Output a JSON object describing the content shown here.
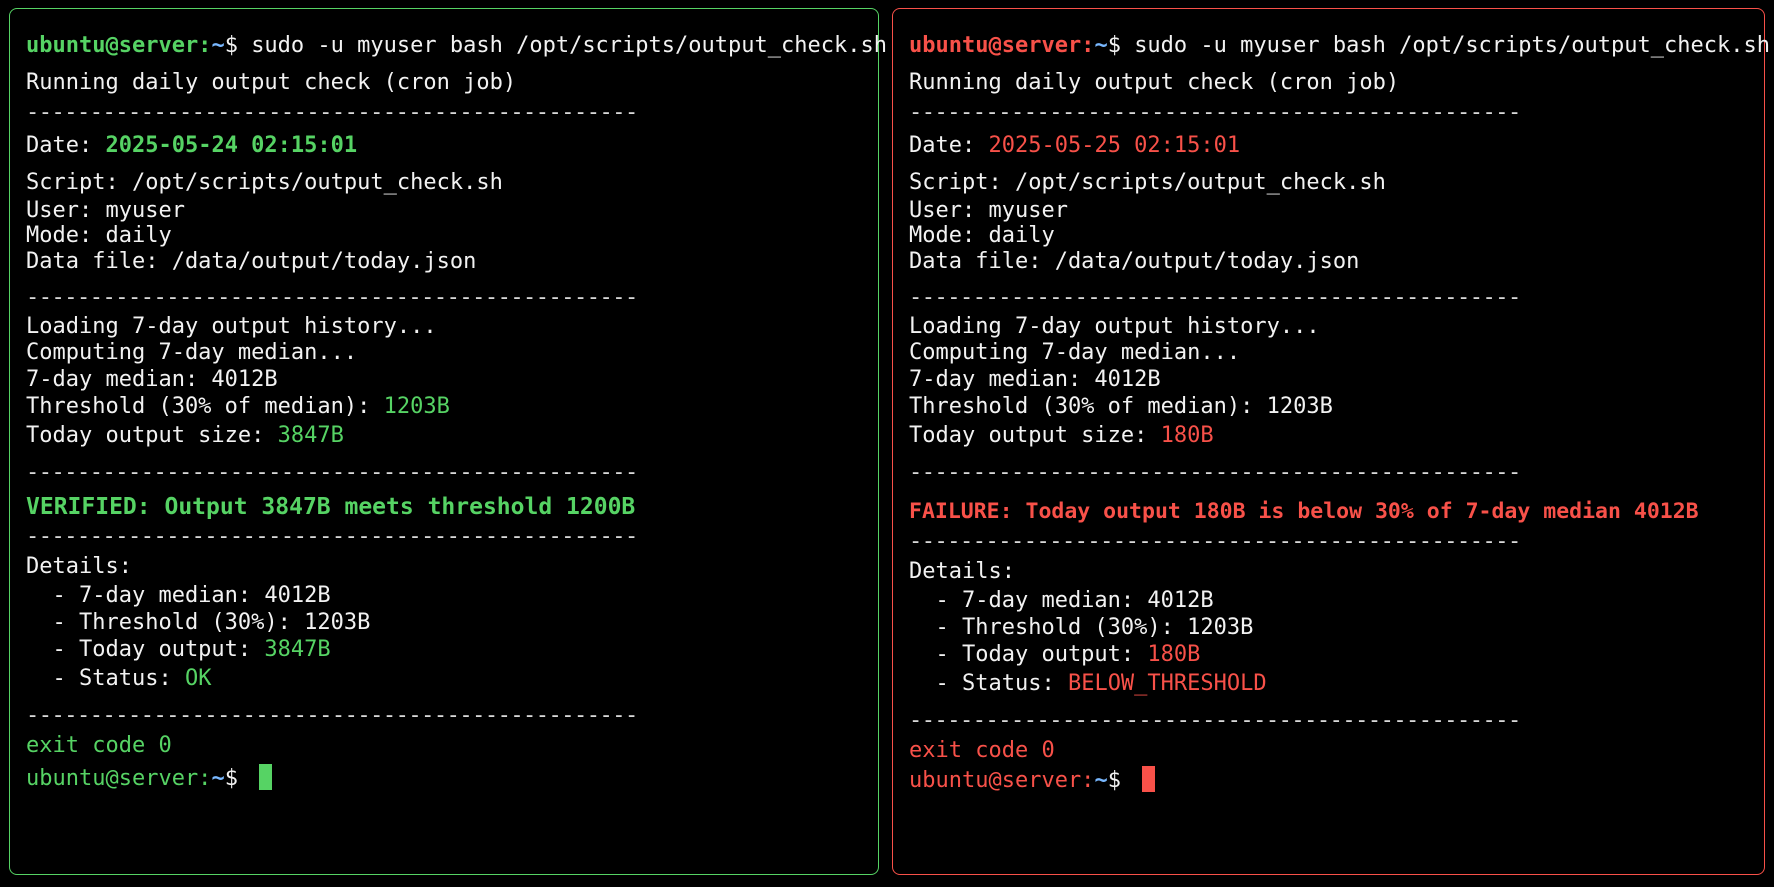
{
  "left": {
    "prompt_user": "ubuntu@server:",
    "prompt_path": "~",
    "prompt_symbol": "$ ",
    "command": "sudo -u myuser bash /opt/scripts/output_check.sh",
    "title": "Running daily output check (cron job)",
    "divider": "------------------------------------------------",
    "date_label": "Date: ",
    "date_value": "2025-05-24 02:15:01",
    "script_line": "Script: /opt/scripts/output_check.sh",
    "user_line": "User: myuser",
    "mode_line": "Mode: daily",
    "datafile_line": "Data file: /data/output/today.json",
    "loading_line": "Loading 7-day output history...",
    "computing_line": "Computing 7-day median...",
    "median_line": "7-day median: 4012B",
    "threshold_label": "Threshold (30% of median): ",
    "threshold_value": "1203B",
    "today_label": "Today output size: ",
    "today_value": "3847B",
    "headline": "VERIFIED: Output 3847B meets threshold 1200B",
    "details_label": "Details:",
    "detail_median": "  - 7-day median: 4012B",
    "detail_threshold": "  - Threshold (30%): 1203B",
    "detail_today_label": "  - Today output: ",
    "detail_today_value": "3847B",
    "detail_status_label": "  - Status: ",
    "detail_status_value": "OK",
    "exit_line": "exit code 0"
  },
  "right": {
    "prompt_user": "ubuntu@server:",
    "prompt_path": "~",
    "prompt_symbol": "$ ",
    "command": "sudo -u myuser bash /opt/scripts/output_check.sh",
    "title": "Running daily output check (cron job)",
    "divider": "------------------------------------------------",
    "date_label": "Date: ",
    "date_value": "2025-05-25 02:15:01",
    "script_line": "Script: /opt/scripts/output_check.sh",
    "user_line": "User: myuser",
    "mode_line": "Mode: daily",
    "datafile_line": "Data file: /data/output/today.json",
    "loading_line": "Loading 7-day output history...",
    "computing_line": "Computing 7-day median...",
    "median_line": "7-day median: 4012B",
    "threshold_label": "Threshold (30% of median): ",
    "threshold_value": "1203B",
    "today_label": "Today output size: ",
    "today_value": "180B",
    "headline": "FAILURE: Today output 180B is below 30% of 7-day median 4012B",
    "details_label": "Details:",
    "detail_median": "  - 7-day median: 4012B",
    "detail_threshold": "  - Threshold (30%): 1203B",
    "detail_today_label": "  - Today output: ",
    "detail_today_value": "180B",
    "detail_status_label": "  - Status: ",
    "detail_status_value": "BELOW_THRESHOLD",
    "exit_line": "exit code 0"
  },
  "colors": {
    "success": "#56d364",
    "failure": "#f85149",
    "path": "#79b8ff"
  }
}
